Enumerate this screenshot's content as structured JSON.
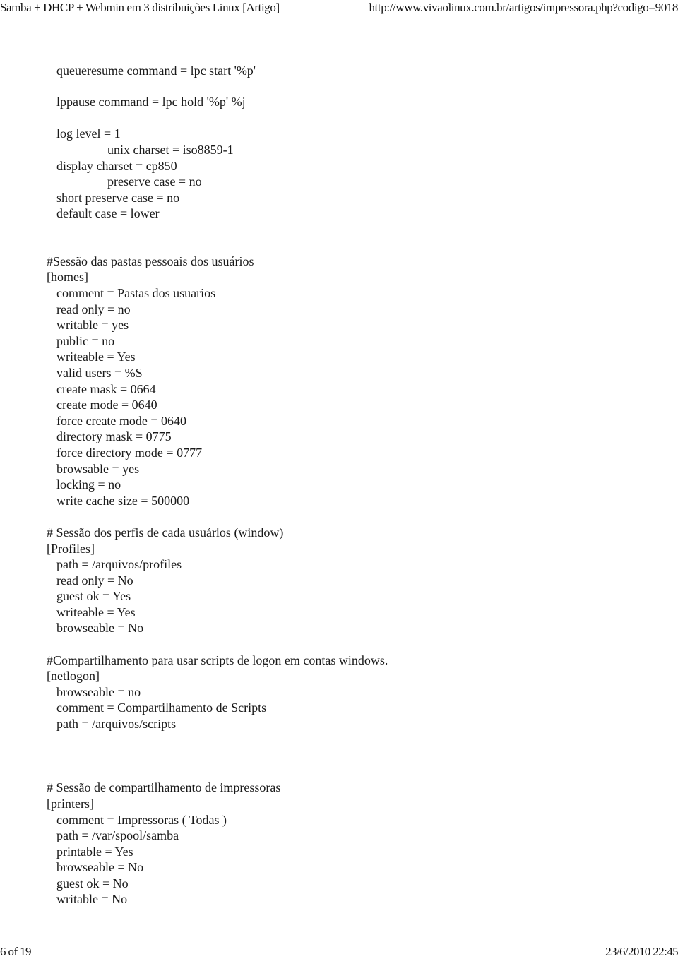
{
  "header": {
    "title": "Samba + DHCP + Webmin em 3 distribuições Linux [Artigo]",
    "url": "http://www.vivaolinux.com.br/artigos/impressora.php?codigo=9018"
  },
  "footer": {
    "page": "6 of 19",
    "datetime": "23/6/2010 22:45"
  },
  "document": {
    "lines": [
      "queueresume command = lpc start '%p'",
      "lppause command = lpc hold '%p' %j",
      "log level = 1",
      "unix charset = iso8859-1",
      "display charset = cp850",
      "preserve case = no",
      "short preserve case = no",
      "default case = lower",
      "#Sessão das pastas pessoais dos usuários",
      "[homes]",
      "comment = Pastas dos usuarios",
      "read only = no",
      "writable = yes",
      "public = no",
      "writeable = Yes",
      "valid users = %S",
      "create mask = 0664",
      "create mode = 0640",
      "force create mode = 0640",
      "directory mask = 0775",
      "force directory mode = 0777",
      "browsable = yes",
      "locking = no",
      "write cache size = 500000",
      "# Sessão dos perfis de cada usuários (window)",
      "[Profiles]",
      "path = /arquivos/profiles",
      "read only = No",
      "guest ok = Yes",
      "writeable = Yes",
      "browseable = No",
      "#Compartilhamento para usar scripts de logon em contas windows.",
      "[netlogon]",
      "browseable = no",
      "comment = Compartilhamento de Scripts",
      "path = /arquivos/scripts",
      "# Sessão de compartilhamento de impressoras",
      "[printers]",
      "comment = Impressoras ( Todas )",
      "path = /var/spool/samba",
      "printable = Yes",
      "browseable = No",
      "guest ok = No",
      "writable = No"
    ]
  }
}
